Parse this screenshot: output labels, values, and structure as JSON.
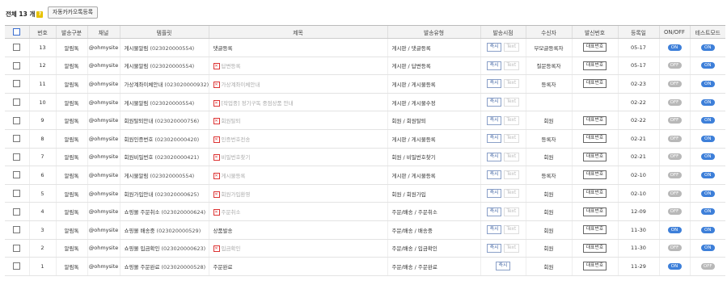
{
  "header": {
    "total_label": "전체 13 개",
    "help_icon": "?",
    "register_button": "자동카카오톡등록"
  },
  "table": {
    "columns": [
      "번호",
      "발송구분",
      "채널",
      "템플릿",
      "제목",
      "발송유형",
      "발송시점",
      "수신자",
      "발신번호",
      "등록일",
      "ON/OFF",
      "테스트모드"
    ],
    "button_labels": {
      "immediate": "즉시",
      "text": "Text",
      "rep_number": "대표번호"
    },
    "rows": [
      {
        "no": "13",
        "type": "알림톡",
        "channel": "@ohmysite",
        "tpl_name": "게시물알림",
        "tpl_code": "(023020000554)",
        "title": "댓글등록",
        "title_error": false,
        "send_type": "게시판 / 댓글등록",
        "text_btn": true,
        "recipient": "부모글등록자",
        "rep_btn": true,
        "date": "05-17",
        "onoff": "ON",
        "test": "ON"
      },
      {
        "no": "12",
        "type": "알림톡",
        "channel": "@ohmysite",
        "tpl_name": "게시물알림",
        "tpl_code": "(023020000554)",
        "title": "답변등록",
        "title_error": true,
        "send_type": "게시판 / 답변등록",
        "text_btn": true,
        "recipient": "질문등록자",
        "rep_btn": true,
        "date": "05-17",
        "onoff": "OFF",
        "test": "ON"
      },
      {
        "no": "11",
        "type": "알림톡",
        "channel": "@ohmysite",
        "tpl_name": "가상계좌이체안내",
        "tpl_code": "(023020000932)",
        "title": "가상계좌이체안내",
        "title_error": true,
        "send_type": "게시판 / 게시물등록",
        "text_btn": true,
        "recipient": "등록자",
        "rep_btn": true,
        "date": "02-23",
        "onoff": "OFF",
        "test": "ON"
      },
      {
        "no": "10",
        "type": "알림톡",
        "channel": "@ohmysite",
        "tpl_name": "게시물알림",
        "tpl_code": "(023020000554)",
        "title": "[작업중] 정기구독 중점상품 안내",
        "title_error": true,
        "send_type": "게시판 / 게시물수정",
        "text_btn": true,
        "recipient": "",
        "rep_btn": false,
        "date": "02-22",
        "onoff": "OFF",
        "test": "ON"
      },
      {
        "no": "9",
        "type": "알림톡",
        "channel": "@ohmysite",
        "tpl_name": "회원탈퇴안내",
        "tpl_code": "(023020000756)",
        "title": "회원탈퇴",
        "title_error": true,
        "send_type": "회원 / 회원탈퇴",
        "text_btn": true,
        "recipient": "회원",
        "rep_btn": true,
        "date": "02-22",
        "onoff": "OFF",
        "test": "ON"
      },
      {
        "no": "8",
        "type": "알림톡",
        "channel": "@ohmysite",
        "tpl_name": "회원인증번호",
        "tpl_code": "(023020000420)",
        "title": "인증번호전송",
        "title_error": true,
        "send_type": "게시판 / 게시물등록",
        "text_btn": true,
        "recipient": "등록자",
        "rep_btn": true,
        "date": "02-21",
        "onoff": "OFF",
        "test": "ON"
      },
      {
        "no": "7",
        "type": "알림톡",
        "channel": "@ohmysite",
        "tpl_name": "회원비밀번호",
        "tpl_code": "(023020000421)",
        "title": "비밀번호찾기",
        "title_error": true,
        "send_type": "회원 / 비밀번호찾기",
        "text_btn": true,
        "recipient": "회원",
        "rep_btn": true,
        "date": "02-21",
        "onoff": "OFF",
        "test": "ON"
      },
      {
        "no": "6",
        "type": "알림톡",
        "channel": "@ohmysite",
        "tpl_name": "게시물알림",
        "tpl_code": "(023020000554)",
        "title": "게시물등록",
        "title_error": true,
        "send_type": "게시판 / 게시물등록",
        "text_btn": true,
        "recipient": "등록자",
        "rep_btn": true,
        "date": "02-10",
        "onoff": "OFF",
        "test": "ON"
      },
      {
        "no": "5",
        "type": "알림톡",
        "channel": "@ohmysite",
        "tpl_name": "회원가입안내",
        "tpl_code": "(023020000625)",
        "title": "회원가입환영",
        "title_error": true,
        "send_type": "회원 / 회원가입",
        "text_btn": true,
        "recipient": "회원",
        "rep_btn": true,
        "date": "02-10",
        "onoff": "OFF",
        "test": "ON"
      },
      {
        "no": "4",
        "type": "알림톡",
        "channel": "@ohmysite",
        "tpl_name": "쇼핑몰 주문취소",
        "tpl_code": "(023020000624)",
        "title": "주문취소",
        "title_error": true,
        "send_type": "주문/배송 / 주문취소",
        "text_btn": true,
        "recipient": "회원",
        "rep_btn": true,
        "date": "12-09",
        "onoff": "OFF",
        "test": "ON"
      },
      {
        "no": "3",
        "type": "알림톡",
        "channel": "@ohmysite",
        "tpl_name": "쇼핑몰 배송중",
        "tpl_code": "(023020000529)",
        "title": "상품발송",
        "title_error": false,
        "send_type": "주문/배송 / 배송중",
        "text_btn": true,
        "recipient": "회원",
        "rep_btn": true,
        "date": "11-30",
        "onoff": "ON",
        "test": "ON"
      },
      {
        "no": "2",
        "type": "알림톡",
        "channel": "@ohmysite",
        "tpl_name": "쇼핑몰 입금확인",
        "tpl_code": "(023020000623)",
        "title": "입금확인",
        "title_error": true,
        "send_type": "주문/배송 / 입금확인",
        "text_btn": true,
        "recipient": "회원",
        "rep_btn": true,
        "date": "11-30",
        "onoff": "OFF",
        "test": "ON"
      },
      {
        "no": "1",
        "type": "알림톡",
        "channel": "@ohmysite",
        "tpl_name": "쇼핑몰 주문완료",
        "tpl_code": "(023020000528)",
        "title": "주문완료",
        "title_error": false,
        "send_type": "주문/배송 / 주문완료",
        "text_btn": false,
        "recipient": "회원",
        "rep_btn": true,
        "date": "11-29",
        "onoff": "ON",
        "test": "OFF"
      }
    ]
  }
}
